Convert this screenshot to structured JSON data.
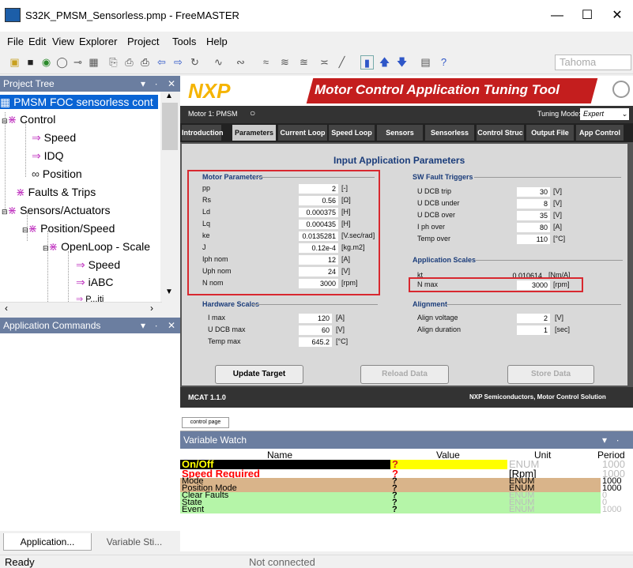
{
  "window": {
    "title": "S32K_PMSM_Sensorless.pmp - FreeMASTER"
  },
  "menu": [
    "File",
    "Edit",
    "View",
    "Explorer",
    "Project",
    "Tools",
    "Help"
  ],
  "toolbar": {
    "font": "Tahoma"
  },
  "project_tree": {
    "header": "Project Tree",
    "items": [
      {
        "label": "PMSM FOC sensorless cont",
        "icon": "project-icon"
      },
      {
        "label": "Control",
        "icon": "folder-icon"
      },
      {
        "label": "Speed",
        "icon": "scope-icon"
      },
      {
        "label": "IDQ",
        "icon": "scope-icon"
      },
      {
        "label": "Position",
        "icon": "recorder-icon"
      },
      {
        "label": "Faults & Trips",
        "icon": "folder-icon"
      },
      {
        "label": "Sensors/Actuators",
        "icon": "folder-icon"
      },
      {
        "label": "Position/Speed",
        "icon": "folder-icon"
      },
      {
        "label": "OpenLoop - Scale",
        "icon": "folder-icon"
      },
      {
        "label": "Speed",
        "icon": "scope-icon"
      },
      {
        "label": "iABC",
        "icon": "scope-icon"
      },
      {
        "label": "P...iti",
        "icon": "scope-icon"
      }
    ]
  },
  "app_commands": {
    "header": "Application Commands"
  },
  "bottom_tabs": [
    "Application...",
    "Variable Sti..."
  ],
  "status": {
    "left": "Ready",
    "center": "Not connected"
  },
  "mcat": {
    "logo": "NXP",
    "title": "Motor Control Application Tuning Tool",
    "motor_label": "Motor 1:  PMSM",
    "tuning_mode_label": "Tuning Mode:",
    "tuning_mode_value": "Expert",
    "tabs": [
      "Introduction",
      "Parameters",
      "Current Loop",
      "Speed Loop",
      "Sensors",
      "Sensorless",
      "Control Struc",
      "Output File",
      "App Control"
    ],
    "panel_title": "Input Application Parameters",
    "motor_params": {
      "title": "Motor Parameters",
      "rows": [
        {
          "label": "pp",
          "value": "2",
          "unit": "[-]"
        },
        {
          "label": "Rs",
          "value": "0.56",
          "unit": "[Ω]"
        },
        {
          "label": "Ld",
          "value": "0.000375",
          "unit": "[H]"
        },
        {
          "label": "Lq",
          "value": "0.000435",
          "unit": "[H]"
        },
        {
          "label": "ke",
          "value": "0.0135281",
          "unit": "[V.sec/rad]"
        },
        {
          "label": "J",
          "value": "0.12e-4",
          "unit": "[kg.m2]"
        },
        {
          "label": "Iph nom",
          "value": "12",
          "unit": "[A]"
        },
        {
          "label": "Uph nom",
          "value": "24",
          "unit": "[V]"
        },
        {
          "label": "N nom",
          "value": "3000",
          "unit": "[rpm]"
        }
      ]
    },
    "hw_scales": {
      "title": "Hardware Scales",
      "rows": [
        {
          "label": "I max",
          "value": "120",
          "unit": "[A]"
        },
        {
          "label": "U DCB max",
          "value": "60",
          "unit": "[V]"
        },
        {
          "label": "Temp max",
          "value": "645.2",
          "unit": "[°C]"
        }
      ]
    },
    "fault_triggers": {
      "title": "SW Fault Triggers",
      "rows": [
        {
          "label": "U DCB trip",
          "value": "30",
          "unit": "[V]"
        },
        {
          "label": "U DCB under",
          "value": "8",
          "unit": "[V]"
        },
        {
          "label": "U DCB over",
          "value": "35",
          "unit": "[V]"
        },
        {
          "label": "I ph over",
          "value": "80",
          "unit": "[A]"
        },
        {
          "label": "Temp over",
          "value": "110",
          "unit": "[°C]"
        }
      ]
    },
    "app_scales": {
      "title": "Application Scales",
      "rows": [
        {
          "label": "kt",
          "value": "0.010614",
          "unit": "[Nm/A]"
        },
        {
          "label": "N max",
          "value": "3000",
          "unit": "[rpm]"
        }
      ]
    },
    "alignment": {
      "title": "Alignment",
      "rows": [
        {
          "label": "Align voltage",
          "value": "2",
          "unit": "[V]"
        },
        {
          "label": "Align duration",
          "value": "1",
          "unit": "[sec]"
        }
      ]
    },
    "buttons": {
      "update": "Update Target",
      "reload": "Reload Data",
      "store": "Store Data"
    },
    "footer_left": "MCAT 1.1.0",
    "footer_right": "NXP Semiconductors, Motor Control Solution"
  },
  "control_page_tab": "control page",
  "variable_watch": {
    "header": "Variable Watch",
    "columns": [
      "Name",
      "Value",
      "Unit",
      "Period"
    ],
    "rows": [
      {
        "name": "On/Off",
        "value": "?",
        "unit": "ENUM",
        "period": "1000",
        "bg": "#000000",
        "fg": "#ffff00",
        "vbg": "#ffff00",
        "vfg": "#d81b1b"
      },
      {
        "name": "Speed Required",
        "value": "?",
        "unit": "[Rpm]",
        "period": "1000",
        "bg": "#ffffff",
        "fg": "#ff0000",
        "vbg": "#ffffff",
        "vfg": "#ff0000"
      },
      {
        "name": "Mode",
        "value": "?",
        "unit": "ENUM",
        "period": "1000",
        "bg": "#d9b48a",
        "fg": "#000000",
        "vbg": "#d9b48a",
        "vfg": "#000000"
      },
      {
        "name": "Position Mode",
        "value": "?",
        "unit": "ENUM",
        "period": "1000",
        "bg": "#d9b48a",
        "fg": "#000000",
        "vbg": "#d9b48a",
        "vfg": "#000000"
      },
      {
        "name": "Clear Faults",
        "value": "?",
        "unit": "ENUM",
        "period": "0",
        "bg": "#b5f5a8",
        "fg": "#000000",
        "vbg": "#b5f5a8",
        "vfg": "#000000"
      },
      {
        "name": "State",
        "value": "?",
        "unit": "ENUM",
        "period": "0",
        "bg": "#b5f5a8",
        "fg": "#000000",
        "vbg": "#b5f5a8",
        "vfg": "#000000"
      },
      {
        "name": "Event",
        "value": "?",
        "unit": "ENUM",
        "period": "1000",
        "bg": "#b5f5a8",
        "fg": "#000000",
        "vbg": "#b5f5a8",
        "vfg": "#000000"
      }
    ]
  }
}
